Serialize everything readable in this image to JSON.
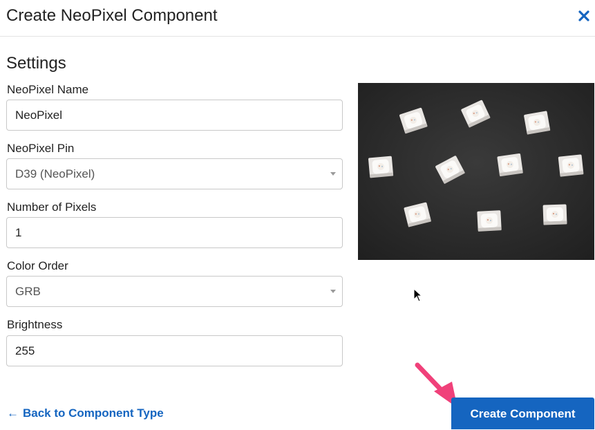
{
  "modal": {
    "title": "Create NeoPixel Component"
  },
  "settings": {
    "heading": "Settings",
    "fields": [
      {
        "label": "NeoPixel Name",
        "value": "NeoPixel",
        "kind": "text"
      },
      {
        "label": "NeoPixel Pin",
        "value": "D39 (NeoPixel)",
        "kind": "select"
      },
      {
        "label": "Number of Pixels",
        "value": "1",
        "kind": "text"
      },
      {
        "label": "Color Order",
        "value": "GRB",
        "kind": "select"
      },
      {
        "label": "Brightness",
        "value": "255",
        "kind": "text"
      }
    ]
  },
  "footer": {
    "back_arrow": "←",
    "back_label": "Back to Component Type",
    "create_label": "Create Component"
  },
  "icons": {
    "close": "close-icon",
    "caret": "chevron-down-icon",
    "cursor": "mouse-pointer-icon",
    "annotation": "pink-arrow-icon"
  },
  "colors": {
    "primary": "#1565c0",
    "annotation": "#f0417a",
    "photo_background": "#2c2c2c"
  }
}
